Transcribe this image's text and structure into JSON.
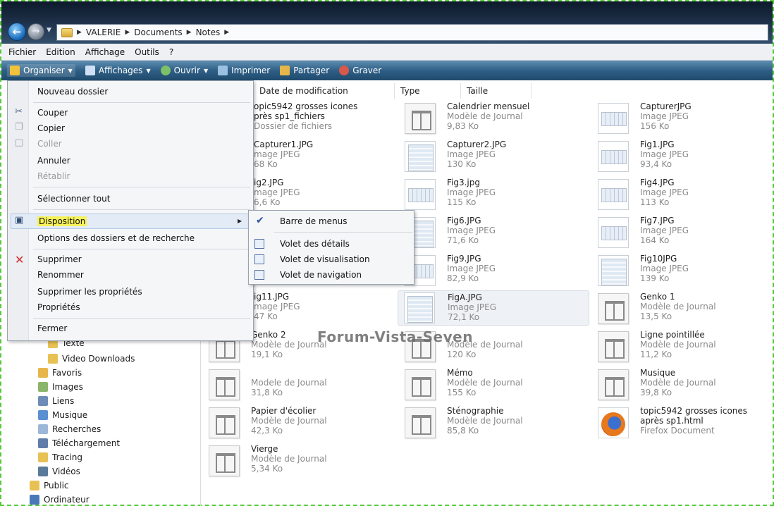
{
  "breadcrumb": [
    "VALERIE",
    "Documents",
    "Notes"
  ],
  "menubar": [
    "Fichier",
    "Edition",
    "Affichage",
    "Outils",
    "?"
  ],
  "toolbar": {
    "organiser": "Organiser",
    "affichages": "Affichages",
    "ouvrir": "Ouvrir",
    "imprimer": "Imprimer",
    "partager": "Partager",
    "graver": "Graver"
  },
  "columns": [
    "Date de modification",
    "Type",
    "Taille"
  ],
  "menu": {
    "nouveau_dossier": "Nouveau dossier",
    "couper": "Couper",
    "copier": "Copier",
    "coller": "Coller",
    "annuler": "Annuler",
    "retablir": "Rétablir",
    "selectionner_tout": "Sélectionner tout",
    "disposition": "Disposition",
    "options": "Options des dossiers et de recherche",
    "supprimer": "Supprimer",
    "renommer": "Renommer",
    "supprimer_proprietes": "Supprimer les propriétés",
    "proprietes": "Propriétés",
    "fermer": "Fermer"
  },
  "submenu": {
    "barre_menus": "Barre de menus",
    "volet_details": "Volet des détails",
    "volet_visualisation": "Volet de visualisation",
    "volet_navigation": "Volet de navigation"
  },
  "sidebar": [
    "Texte",
    "Video Downloads",
    "Favoris",
    "Images",
    "Liens",
    "Musique",
    "Recherches",
    "Téléchargement",
    "Tracing",
    "Vidéos",
    "Public",
    "Ordinateur"
  ],
  "watermark": "Forum-Vista-Seven",
  "files": [
    {
      "name": "opic5942 grosses icones",
      "name2": "près sp1_fichiers",
      "type": "Dossier de fichiers",
      "size": ""
    },
    {
      "name": "Calendrier mensuel",
      "type": "Modèle de Journal",
      "size": "9,83 Ko"
    },
    {
      "name": "CapturerJPG",
      "type": "Image JPEG",
      "size": "156 Ko"
    },
    {
      "name": "Capturer1.JPG",
      "type": "mage JPEG",
      "size": "68 Ko"
    },
    {
      "name": "Capturer2.JPG",
      "type": "Image JPEG",
      "size": "130 Ko"
    },
    {
      "name": "Fig1.JPG",
      "type": "Image JPEG",
      "size": "93,4 Ko"
    },
    {
      "name": "ig2.JPG",
      "type": "mage JPEG",
      "size": "6,6 Ko"
    },
    {
      "name": "Fig3.jpg",
      "type": "Image JPEG",
      "size": "115 Ko"
    },
    {
      "name": "Fig4.JPG",
      "type": "Image JPEG",
      "size": "113 Ko"
    },
    {
      "name": "Fig6.JPG",
      "type": "Image JPEG",
      "size": "71,6 Ko"
    },
    {
      "name": "Fig7.JPG",
      "type": "Image JPEG",
      "size": "164 Ko"
    },
    {
      "name": "Fig9.JPG",
      "type": "Image JPEG",
      "size": "82,9 Ko"
    },
    {
      "name": "Fig10JPG",
      "type": "Image JPEG",
      "size": "139 Ko"
    },
    {
      "name": "ig11.JPG",
      "type": "mage JPEG",
      "size": "47 Ko"
    },
    {
      "name": "FigA.JPG",
      "type": "Image JPEG",
      "size": "72,1 Ko"
    },
    {
      "name": "Genko 1",
      "type": "Modèle de Journal",
      "size": "13,5 Ko"
    },
    {
      "name": "Genko 2",
      "type": "Modèle de Journal",
      "size": "19,1 Ko"
    },
    {
      "name": "",
      "type": "Modèle de Journal",
      "size": "120 Ko"
    },
    {
      "name": "Ligne pointillée",
      "type": "Modèle de Journal",
      "size": "11,2 Ko"
    },
    {
      "name": "",
      "type": "Modele de Journal",
      "size": "31,8 Ko"
    },
    {
      "name": "Mémo",
      "type": "Modèle de Journal",
      "size": "155 Ko"
    },
    {
      "name": "Musique",
      "type": "Modèle de Journal",
      "size": "39,8 Ko"
    },
    {
      "name": "Papier d'écolier",
      "type": "Modèle de Journal",
      "size": "42,3 Ko"
    },
    {
      "name": "Sténographie",
      "type": "Modèle de Journal",
      "size": "85,8 Ko"
    },
    {
      "name": "topic5942 grosses icones",
      "name2": "après sp1.html",
      "type": "Firefox Document",
      "size": ""
    },
    {
      "name": "Vierge",
      "type": "Modèle de Journal",
      "size": "5,34 Ko"
    }
  ]
}
